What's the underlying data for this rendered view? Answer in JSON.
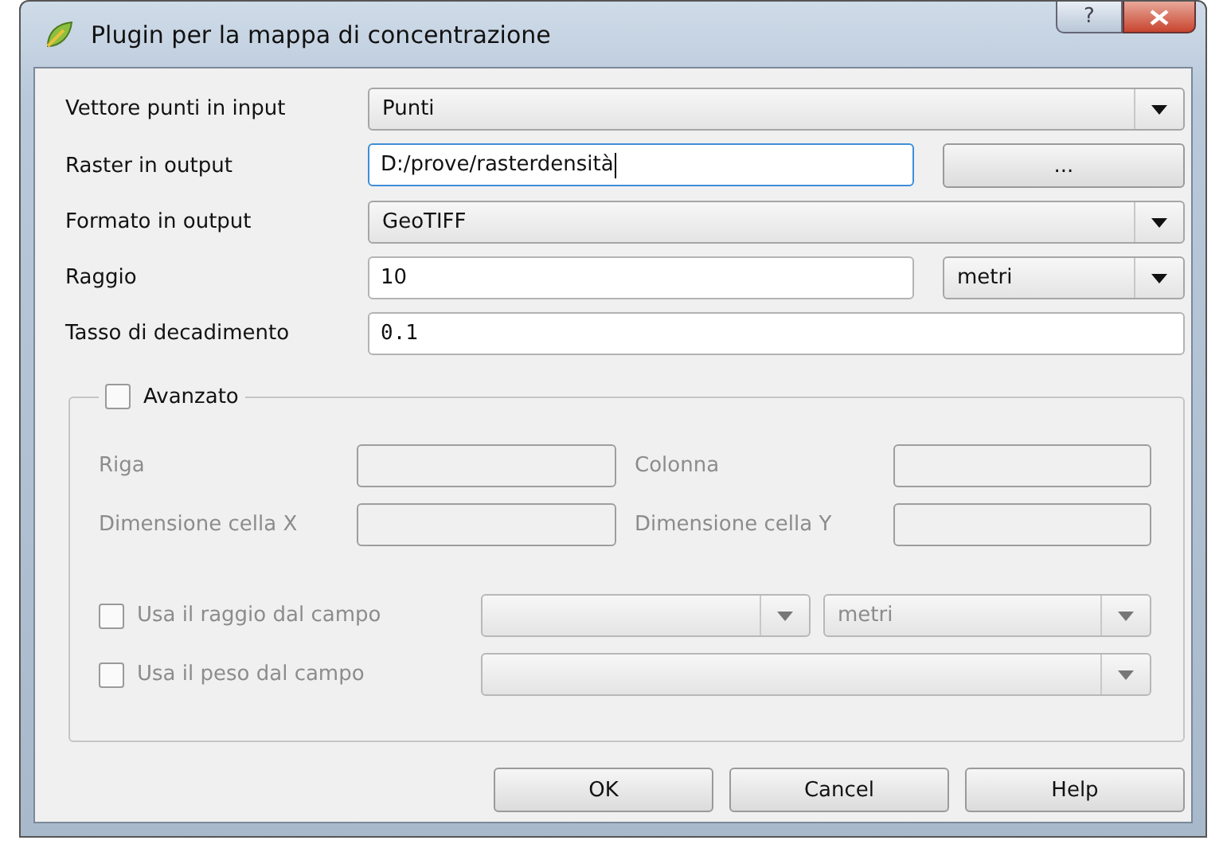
{
  "window": {
    "title": "Plugin per la mappa di concentrazione",
    "help_button": "?"
  },
  "fields": [
    {
      "kind": "combo",
      "label": "Vettore punti in input",
      "value": "Punti"
    },
    {
      "kind": "text",
      "label": "Raster in output",
      "value": "D:/prove/rasterdensità",
      "focused": true,
      "button": "..."
    },
    {
      "kind": "combo",
      "label": "Formato in output",
      "value": "GeoTIFF"
    },
    {
      "kind": "text",
      "label": "Raggio",
      "value": "10",
      "focused": false,
      "unit": "metri"
    },
    {
      "kind": "mono",
      "label": "Tasso di decadimento",
      "value": "0.1",
      "focused": false
    }
  ],
  "advanced": {
    "label": "Avanzato",
    "checked": false,
    "disabled": true,
    "grid": [
      {
        "label": "Riga"
      },
      {
        "label": "Colonna"
      },
      {
        "label": "Dimensione cella X"
      },
      {
        "label": "Dimensione cella Y"
      }
    ],
    "options": [
      {
        "label": "Usa il raggio dal campo",
        "checked": false,
        "unit": "metri"
      },
      {
        "label": "Usa il peso dal campo",
        "checked": false
      }
    ]
  },
  "buttons": [
    "OK",
    "Cancel",
    "Help"
  ]
}
